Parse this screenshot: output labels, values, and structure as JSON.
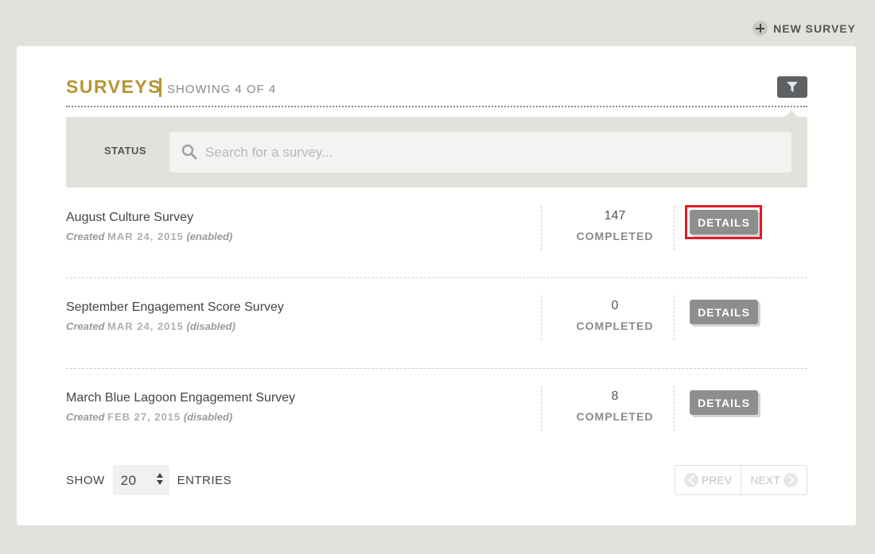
{
  "top_action": {
    "new_survey_label": "NEW SURVEY",
    "icon": "plus-circle-icon"
  },
  "header": {
    "title": "SURVEYS",
    "showing": "SHOWING 4 OF 4",
    "filter_icon": "filter-icon"
  },
  "filter": {
    "status_label": "STATUS",
    "search_placeholder": "Search for a survey...",
    "search_value": ""
  },
  "surveys": [
    {
      "name": "August Culture Survey",
      "created_label": "Created",
      "date": "MAR 24, 2015",
      "state": "(enabled)",
      "count": "147",
      "completed_label": "COMPLETED",
      "details_label": "DETAILS",
      "highlighted": true
    },
    {
      "name": "September Engagement Score Survey",
      "created_label": "Created",
      "date": "MAR 24, 2015",
      "state": "(disabled)",
      "count": "0",
      "completed_label": "COMPLETED",
      "details_label": "DETAILS",
      "highlighted": false
    },
    {
      "name": "March Blue Lagoon Engagement Survey",
      "created_label": "Created",
      "date": "FEB 27, 2015",
      "state": "(disabled)",
      "count": "8",
      "completed_label": "COMPLETED",
      "details_label": "DETAILS",
      "highlighted": false
    }
  ],
  "footer": {
    "show_label": "SHOW",
    "entries_value": "20",
    "entries_label": "ENTRIES",
    "prev_label": "PREV",
    "next_label": "NEXT"
  },
  "colors": {
    "accent": "#b69531",
    "background": "#e2e2dd",
    "button": "#8e8e8e",
    "highlight": "#e01b22"
  }
}
